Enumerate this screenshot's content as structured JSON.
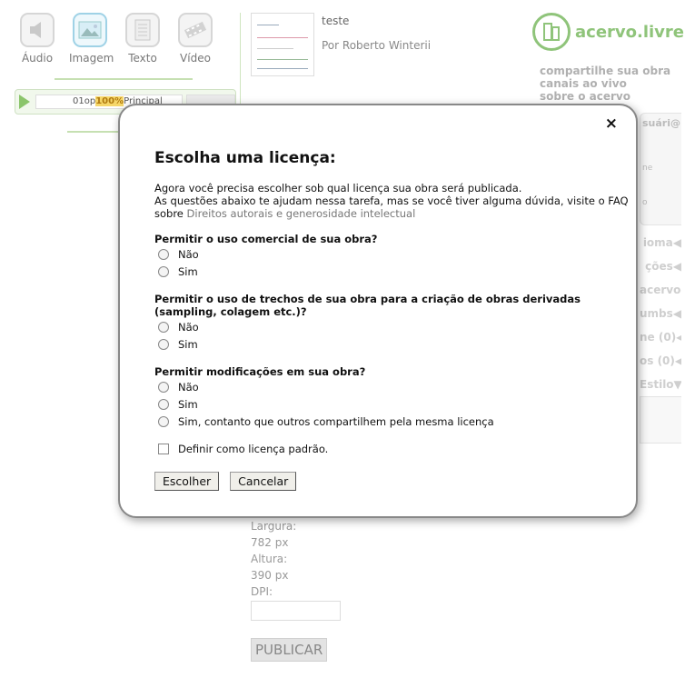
{
  "media_types": [
    {
      "label": "Áudio",
      "icon": "speaker-icon",
      "active": false
    },
    {
      "label": "Imagem",
      "icon": "image-icon",
      "active": true
    },
    {
      "label": "Texto",
      "icon": "document-icon",
      "active": false
    },
    {
      "label": "Vídeo",
      "icon": "film-icon",
      "active": false
    }
  ],
  "player": {
    "text_before": "01op",
    "highlight": "100%",
    "text_after": "Principal"
  },
  "item": {
    "title": "teste",
    "author": "Por Roberto Winterii"
  },
  "logo": {
    "text": "acervo.livre"
  },
  "right_links": [
    "compartilhe sua obra",
    "canais ao vivo",
    "sobre o acervo"
  ],
  "right_panel": {
    "user_label": "suári@",
    "user_line2": "ne",
    "user_line3": "o",
    "items": [
      "ioma◀",
      "ções◀",
      "acervo◀",
      "umbs◀",
      "ne (0)◀",
      "os (0)◀",
      "Estilo▼"
    ]
  },
  "bottom_form": {
    "width_label": "Largura:",
    "width_value": "782 px",
    "height_label": "Altura:",
    "height_value": "390 px",
    "dpi_label": "DPI:",
    "publish_label": "PUBLICAR"
  },
  "modal": {
    "close_label": "×",
    "title": "Escolha uma licença:",
    "intro_line1": "Agora você precisa escolher sob qual licença sua obra será publicada.",
    "intro_line2": "As questões abaixo te ajudam nessa tarefa, mas se você tiver alguma dúvida, visite o FAQ",
    "intro_prefix": "sobre ",
    "intro_link": "Direitos autorais e generosidade intelectual",
    "questions": [
      {
        "text": "Permitir o uso comercial de sua obra?",
        "options": [
          "Não",
          "Sim"
        ]
      },
      {
        "text": "Permitir o uso de trechos de sua obra para a criação de obras derivadas (sampling, colagem etc.)?",
        "options": [
          "Não",
          "Sim"
        ]
      },
      {
        "text": "Permitir modificações em sua obra?",
        "options": [
          "Não",
          "Sim",
          "Sim, contanto que outros compartilhem pela mesma licença"
        ]
      }
    ],
    "default_checkbox_label": "Definir como licença padrão.",
    "choose_button": "Escolher",
    "cancel_button": "Cancelar"
  }
}
